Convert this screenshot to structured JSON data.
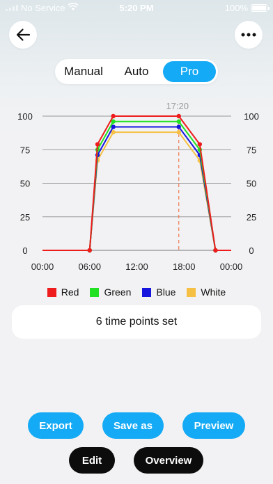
{
  "status_bar": {
    "carrier": "No Service",
    "time": "5:20 PM",
    "battery": "100%"
  },
  "header": {
    "back_icon": "arrow-left-icon",
    "more_icon": "more-horizontal-icon"
  },
  "mode_tabs": [
    {
      "label": "Manual",
      "active": false
    },
    {
      "label": "Auto",
      "active": false
    },
    {
      "label": "Pro",
      "active": true
    }
  ],
  "chart_data": {
    "type": "line",
    "x": [
      "00:00",
      "06:00",
      "07:00",
      "09:00",
      "17:20",
      "20:00",
      "22:00",
      "24:00"
    ],
    "x_hours": [
      0,
      6,
      7,
      9,
      17.333,
      20,
      22,
      24
    ],
    "series": [
      {
        "name": "Red",
        "color": "#ee1c1c",
        "values": [
          0,
          0,
          79,
          100,
          100,
          79,
          0,
          0
        ]
      },
      {
        "name": "Green",
        "color": "#22e122",
        "values": [
          0,
          0,
          75,
          96,
          96,
          75,
          0,
          0
        ]
      },
      {
        "name": "Blue",
        "color": "#1515dd",
        "values": [
          0,
          0,
          71,
          92,
          92,
          71,
          0,
          0
        ]
      },
      {
        "name": "White",
        "color": "#f5c044",
        "values": [
          0,
          0,
          67,
          88,
          88,
          67,
          0,
          0
        ]
      }
    ],
    "x_ticks": [
      "00:00",
      "06:00",
      "12:00",
      "18:00",
      "00:00"
    ],
    "y_ticks": [
      "0",
      "25",
      "50",
      "75",
      "100"
    ],
    "ylim": [
      0,
      100
    ],
    "xlim": [
      0,
      24
    ],
    "marker": {
      "label": "17:20",
      "hour": 17.333
    },
    "legend_position": "bottom"
  },
  "summary": "6 time points set",
  "actions": {
    "export": "Export",
    "save_as": "Save as",
    "preview": "Preview",
    "edit": "Edit",
    "overview": "Overview"
  }
}
